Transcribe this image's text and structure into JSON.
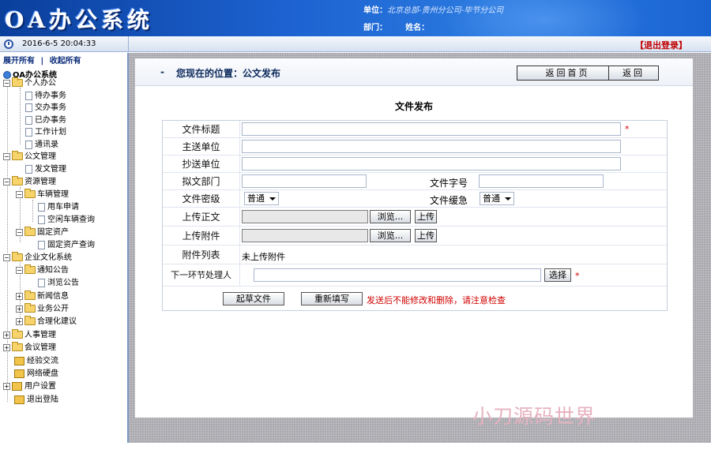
{
  "header": {
    "logo": "OA办公系统",
    "unit_label": "单位：",
    "unit_value": "北京总部-贵州分公司-毕节分公司",
    "dept_label": "部门：",
    "name_label": "姓名："
  },
  "statusbar": {
    "datetime": "2016-6-5 20:04:33",
    "logout": "【退出登录】"
  },
  "sidebar": {
    "expand_all": "展开所有",
    "separator": "|",
    "collapse_all": "收起所有",
    "root": "OA办公系统",
    "items": [
      {
        "label": "个人办公"
      },
      {
        "label": "待办事务"
      },
      {
        "label": "交办事务"
      },
      {
        "label": "已办事务"
      },
      {
        "label": "工作计划"
      },
      {
        "label": "通讯录"
      },
      {
        "label": "公文管理"
      },
      {
        "label": "发文管理"
      },
      {
        "label": "资源管理"
      },
      {
        "label": "车辆管理"
      },
      {
        "label": "用车申请"
      },
      {
        "label": "空闲车辆查询"
      },
      {
        "label": "固定资产"
      },
      {
        "label": "固定资产查询"
      },
      {
        "label": "企业文化系统"
      },
      {
        "label": "通知公告"
      },
      {
        "label": "浏览公告"
      },
      {
        "label": "新闻信息"
      },
      {
        "label": "业务公开"
      },
      {
        "label": "合理化建议"
      },
      {
        "label": "人事管理"
      },
      {
        "label": "会议管理"
      },
      {
        "label": "经验交流"
      },
      {
        "label": "网络硬盘"
      },
      {
        "label": "用户设置"
      },
      {
        "label": "退出登陆"
      }
    ]
  },
  "main": {
    "location": "您现在的位置：公文发布",
    "location_dash": "-",
    "home_button": "返回首页",
    "back_button": "返回",
    "form_title": "文件发布",
    "fields": {
      "title": "文件标题",
      "main_unit": "主送单位",
      "cc_unit": "抄送单位",
      "draft_dept": "拟文部门",
      "doc_number": "文件字号",
      "secrecy": "文件密级",
      "urgency": "文件缓急",
      "upload_body": "上传正文",
      "upload_attach": "上传附件",
      "attach_list": "附件列表",
      "next_handler": "下一环节处理人"
    },
    "secrecy_value": "普通",
    "urgency_value": "普通",
    "browse_label": "浏览...",
    "upload_label": "上传",
    "no_attachments": "未上传附件",
    "select_label": "选择",
    "required_mark": "*",
    "draft_button": "起草文件",
    "reset_button": "重新填写",
    "warning": "发送后不能修改和删除，请注意检查"
  },
  "watermark": "小刀源码世界"
}
